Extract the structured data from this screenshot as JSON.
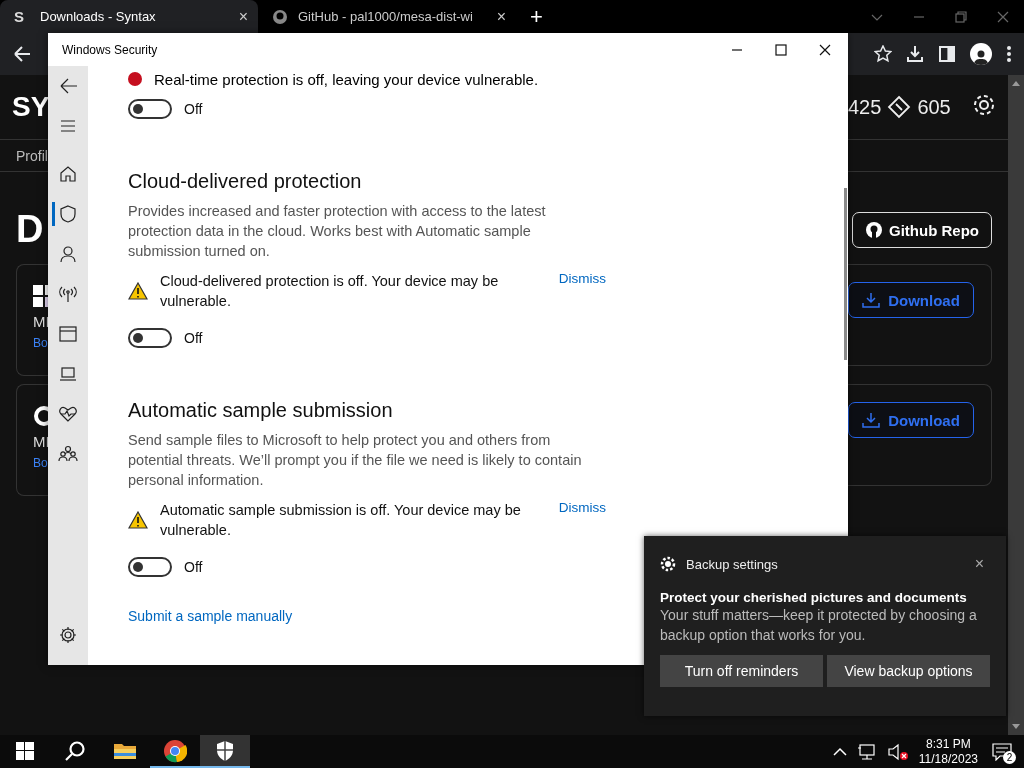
{
  "browser": {
    "tabs": [
      {
        "title": "Downloads - Syntax",
        "favicon": "S",
        "selected": true
      },
      {
        "title": "GitHub - pal1000/mesa-dist-wi",
        "selected": false
      }
    ],
    "close": "×",
    "new_tab": "+"
  },
  "site": {
    "logo": "SY",
    "nav_item": "Profil",
    "heading": "D",
    "stats": [
      "425",
      "605"
    ],
    "repo_button": "Github Repo",
    "cards": [
      {
        "kind": "windows",
        "title": "MI",
        "link": "Bo",
        "button": "Download"
      },
      {
        "kind": "ring",
        "title": "MI",
        "link": "Bo",
        "button": "Download"
      }
    ]
  },
  "security": {
    "title": "Windows Security",
    "nav": [
      {
        "kind": "back",
        "selected": false
      },
      {
        "kind": "menu",
        "selected": false
      },
      {
        "kind": "home",
        "selected": false
      },
      {
        "kind": "shield",
        "selected": true
      },
      {
        "kind": "person",
        "selected": false
      },
      {
        "kind": "antenna",
        "selected": false
      },
      {
        "kind": "window",
        "selected": false
      },
      {
        "kind": "laptop",
        "selected": false
      },
      {
        "kind": "heart",
        "selected": false
      },
      {
        "kind": "family",
        "selected": false
      },
      {
        "kind": "gear",
        "selected": false
      }
    ],
    "top_notice": "Real-time protection is off, leaving your device vulnerable.",
    "top_toggle": {
      "on": false,
      "label": "Off"
    },
    "sections": [
      {
        "heading": "Cloud-delivered protection",
        "description": "Provides increased and faster protection with access to the latest protection data in the cloud. Works best with Automatic sample submission turned on.",
        "warning": "Cloud-delivered protection is off. Your device may be vulnerable.",
        "dismiss": "Dismiss",
        "toggle": {
          "on": false,
          "label": "Off"
        }
      },
      {
        "heading": "Automatic sample submission",
        "description": "Send sample files to Microsoft to help protect you and others from potential threats. We’ll prompt you if the file we need is likely to contain personal information.",
        "warning": "Automatic sample submission is off. Your device may be vulnerable.",
        "dismiss": "Dismiss",
        "toggle": {
          "on": false,
          "label": "Off"
        }
      }
    ],
    "submit_link": "Submit a sample manually"
  },
  "toast": {
    "app": "Backup settings",
    "close": "×",
    "title": "Protect your cherished pictures and documents",
    "body": "Your stuff matters—keep it protected by choosing a backup option that works for you.",
    "buttons": [
      "Turn off reminders",
      "View backup options"
    ]
  },
  "taskbar": {
    "apps": [
      {
        "kind": "start",
        "selected": false,
        "running": false
      },
      {
        "kind": "search",
        "selected": false,
        "running": false
      },
      {
        "kind": "explorer",
        "selected": false,
        "running": false
      },
      {
        "kind": "chrome",
        "selected": false,
        "running": true
      },
      {
        "kind": "security",
        "selected": true,
        "running": true
      }
    ],
    "time": "8:31 PM",
    "date": "11/18/2023",
    "notifications": "2"
  }
}
